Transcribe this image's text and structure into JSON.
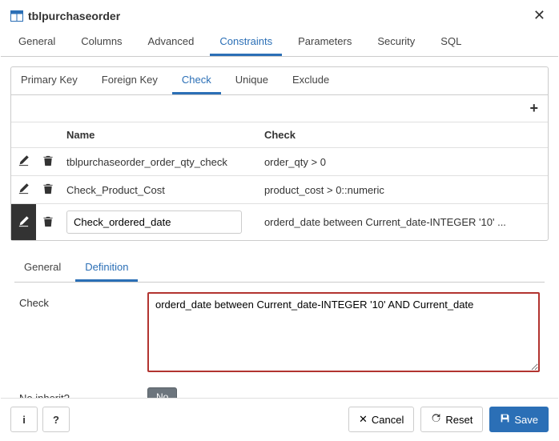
{
  "title": "tblpurchaseorder",
  "main_tabs": [
    "General",
    "Columns",
    "Advanced",
    "Constraints",
    "Parameters",
    "Security",
    "SQL"
  ],
  "main_tab_active": 3,
  "sub_tabs": [
    "Primary Key",
    "Foreign Key",
    "Check",
    "Unique",
    "Exclude"
  ],
  "sub_tab_active": 2,
  "grid": {
    "headers": {
      "name": "Name",
      "check": "Check"
    },
    "rows": [
      {
        "name": "tblpurchaseorder_order_qty_check",
        "check": "order_qty > 0",
        "editing": false
      },
      {
        "name": "Check_Product_Cost",
        "check": "product_cost > 0::numeric",
        "editing": false
      },
      {
        "name": "Check_ordered_date",
        "check": "orderd_date between Current_date-INTEGER '10' ...",
        "editing": true
      }
    ]
  },
  "detail_tabs": [
    "General",
    "Definition"
  ],
  "detail_tab_active": 1,
  "form": {
    "check_label": "Check",
    "check_value": "orderd_date between Current_date-INTEGER '10' AND Current_date",
    "no_inherit_label": "No inherit?",
    "no_inherit_value": "No"
  },
  "footer": {
    "info": "i",
    "help": "?",
    "cancel": "Cancel",
    "reset": "Reset",
    "save": "Save"
  }
}
